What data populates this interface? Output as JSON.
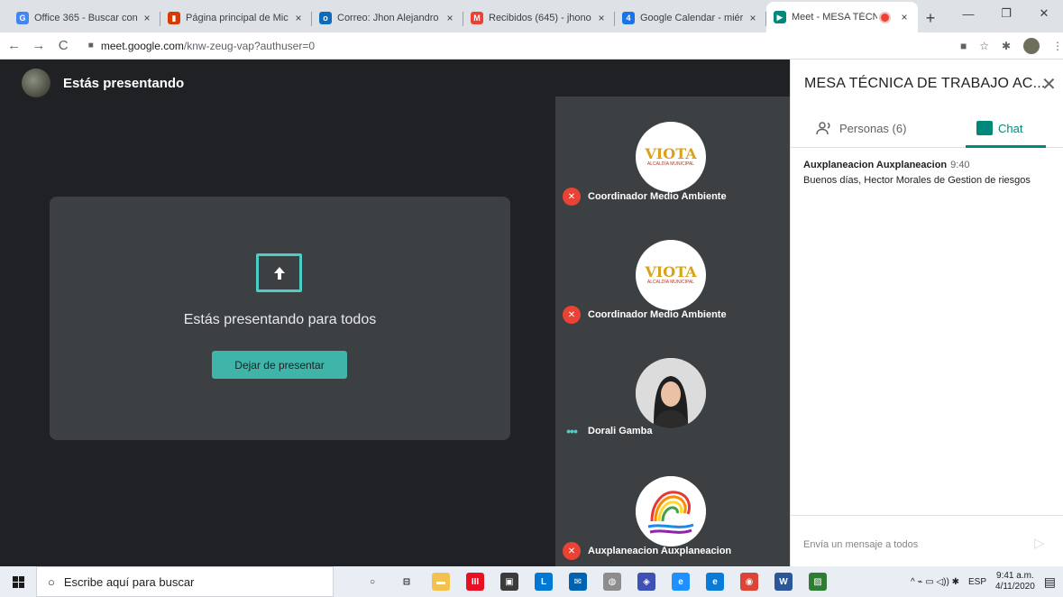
{
  "browser": {
    "tabs": [
      {
        "title": "Office 365 - Buscar con",
        "favicon": "google-icon",
        "color": "#4285f4",
        "glyph": "G"
      },
      {
        "title": "Página principal de Mic",
        "favicon": "office-icon",
        "color": "#d83b01",
        "glyph": "▮"
      },
      {
        "title": "Correo: Jhon Alejandro",
        "favicon": "outlook-icon",
        "color": "#0f6cbd",
        "glyph": "o"
      },
      {
        "title": "Recibidos (645) - jhono",
        "favicon": "gmail-icon",
        "color": "#ea4335",
        "glyph": "M"
      },
      {
        "title": "Google Calendar - miér",
        "favicon": "calendar-icon",
        "color": "#1a73e8",
        "glyph": "4"
      },
      {
        "title": "Meet - MESA TÉCN",
        "favicon": "meet-icon",
        "color": "#00897b",
        "glyph": "▶",
        "active": true
      }
    ],
    "tab_close": "×",
    "new_tab": "+",
    "window": {
      "minimize": "—",
      "maximize": "❐",
      "close": "✕"
    },
    "nav": {
      "back": "←",
      "forward": "→",
      "reload": "C"
    },
    "url_host": "meet.google.com",
    "url_path": "/knw-zeug-vap?authuser=0",
    "lock": "🔒"
  },
  "meet": {
    "presenting_label": "Estás presentando",
    "presenting_all": "Estás presentando para todos",
    "stop_button": "Dejar de presentar",
    "participants": [
      {
        "name": "Coordinador Medio Ambiente",
        "avatar": "viota-logo",
        "status": "mic-off"
      },
      {
        "name": "Coordinador Medio Ambiente",
        "avatar": "viota-logo",
        "status": "mic-off"
      },
      {
        "name": "Dorali Gamba",
        "avatar": "photo",
        "status": "speaking"
      },
      {
        "name": "Auxplaneacion Auxplaneacion",
        "avatar": "swirl-logo",
        "status": "mic-off"
      }
    ],
    "viota_text": "VIOTA",
    "viota_sub": "ALCALDÍA MUNICIPAL"
  },
  "side_panel": {
    "title": "MESA TÉCNICA DE TRABAJO AC...",
    "close": "✕",
    "people_tab": "Personas (6)",
    "chat_tab": "Chat",
    "messages": [
      {
        "sender": "Auxplaneacion Auxplaneacion",
        "time": "9:40",
        "text": "Buenos días, Hector Morales de Gestion de riesgos"
      }
    ],
    "compose_placeholder": "Envía un mensaje a todos",
    "send": "▷"
  },
  "taskbar": {
    "search_placeholder": "Escribe aquí para buscar",
    "apps": [
      {
        "name": "cortana-icon",
        "glyph": "○",
        "color": "transparent",
        "fg": "#202124"
      },
      {
        "name": "task-view-icon",
        "glyph": "⊟",
        "color": "transparent",
        "fg": "#202124"
      },
      {
        "name": "file-explorer-icon",
        "glyph": "▬",
        "color": "#f2c14e",
        "fg": "#fff"
      },
      {
        "name": "office-app-icon",
        "glyph": "III",
        "color": "#e81123",
        "fg": "#fff"
      },
      {
        "name": "store-icon",
        "glyph": "▣",
        "color": "#3b3b3b",
        "fg": "#fff"
      },
      {
        "name": "lync-icon",
        "glyph": "L",
        "color": "#0078d4",
        "fg": "#fff"
      },
      {
        "name": "mail-icon",
        "glyph": "✉",
        "color": "#0063b1",
        "fg": "#fff"
      },
      {
        "name": "network-app-icon",
        "glyph": "◍",
        "color": "#8d8d8d",
        "fg": "#fff"
      },
      {
        "name": "security-icon",
        "glyph": "◈",
        "color": "#3f51b5",
        "fg": "#fff"
      },
      {
        "name": "ie-icon",
        "glyph": "e",
        "color": "#1e90ff",
        "fg": "#fff"
      },
      {
        "name": "edge-icon",
        "glyph": "e",
        "color": "#0a7bd6",
        "fg": "#fff"
      },
      {
        "name": "chrome-icon",
        "glyph": "◉",
        "color": "#db4437",
        "fg": "#fff"
      },
      {
        "name": "word-icon",
        "glyph": "W",
        "color": "#2b579a",
        "fg": "#fff"
      },
      {
        "name": "photos-icon",
        "glyph": "▨",
        "color": "#2e7d32",
        "fg": "#fff"
      }
    ],
    "tray": "^ ⌁ ▭ ◁)) ✱",
    "lang": "ESP",
    "time": "9:41 a.m.",
    "date": "4/11/2020",
    "notif": "▤"
  }
}
